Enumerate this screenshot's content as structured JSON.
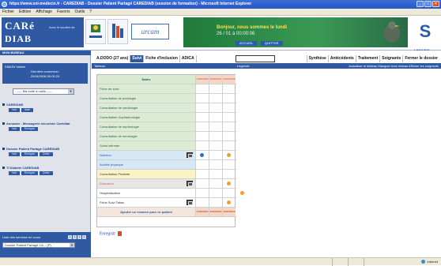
{
  "window": {
    "title": "https://www.sni-medecin.fr - CAREDIAB - Dossier Patient Partagé CAREDIAB (session de formation) - Microsoft Internet Explorer"
  },
  "menu": [
    "Fichier",
    "Edition",
    "Affichage",
    "Favoris",
    "Outils",
    "?"
  ],
  "header": {
    "logo_line1": "CARé",
    "logo_line2": "DIAB",
    "tagline": "Avec le soutien de",
    "urcam": "urcam",
    "date": "Bonjour, nous sommes le lundi",
    "time": "26 / 01 à 00:00:06",
    "btn_accueil": "ACCUEIL",
    "btn_quitter": "QUITTER",
    "right_logo": "S",
    "right_logo_sub": "LIMOUSIN"
  },
  "sidebar": {
    "header": "MON BUREAU",
    "user_line1": "SIMON Valérie",
    "user_line2": "Dernière connexion:",
    "user_line3": "20/04/2006 00:00:24",
    "select": "----- Ma boite à outils -----",
    "blocks": [
      {
        "title": "CAREDIAB",
        "buttons": [
          "Voir",
          "Aide"
        ]
      },
      {
        "title": "Annuaire - Messagerie sécurisée Carédiab",
        "buttons": [
          "Voir",
          "Envoyer"
        ]
      },
      {
        "title": "Dossier Patient Partagé CAREDIAB",
        "buttons": [
          "Voir",
          "Envoyer",
          "Créer"
        ]
      },
      {
        "title": "TI Diabète CAREDIAB",
        "buttons": [
          "Voir",
          "Envoyer",
          "Créer"
        ]
      }
    ],
    "footer_title": "Liste des services en cours",
    "footer_select": "Dossier Patient Partagé CA... (P)",
    "nav": [
      "1",
      "2",
      "3",
      "4"
    ]
  },
  "main": {
    "patient_tabs": [
      {
        "label": "A.DODO (27 ans)",
        "active": false
      },
      {
        "label": "Suivi",
        "active": true
      },
      {
        "label": "Fiche d'inclusion",
        "active": false
      },
      {
        "label": "ADICA",
        "active": false
      }
    ],
    "right_tabs": [
      "Synthèse",
      "Antécédents",
      "Traitement",
      "Soignants",
      "Fermer le dossier"
    ],
    "band_left": "Tableau",
    "band_mid": "Légende",
    "band_right": "Actualiser le tableau  Masquer hors réseau  Afficher les soignants",
    "grid_header_label": "Dates",
    "grid_header_cols": [
      "12/05/2005",
      "20/05/2005",
      "26/05/2005"
    ],
    "rows": [
      {
        "label": "Fiche de suivi",
        "style": "green"
      },
      {
        "label": "Consultation de podologie",
        "style": "green"
      },
      {
        "label": "Consultation de cardiologie",
        "style": "green"
      },
      {
        "label": "Consultation d'ophtalmologie",
        "style": "green"
      },
      {
        "label": "Consultation de néphrologie",
        "style": "green"
      },
      {
        "label": "Consultation de neurologie",
        "style": "green"
      },
      {
        "label": "Soins infirmier",
        "style": "green"
      },
      {
        "label": "Nutrition",
        "style": "lightblue",
        "icon": true,
        "dots": [
          {
            "col": 0,
            "color": "blue"
          },
          {
            "col": 2,
            "color": "orange"
          }
        ]
      },
      {
        "label": "Activité physique",
        "style": "lightblue"
      },
      {
        "label": "Consultation Pédiatre",
        "style": "yellow"
      },
      {
        "label": "Education",
        "style": "pinklabel",
        "icon": true,
        "dots": [
          {
            "col": 2,
            "color": "orange"
          }
        ]
      },
      {
        "label": "Hospitalisation",
        "style": "white",
        "dots": [
          {
            "col": 3,
            "color": "orange"
          }
        ]
      },
      {
        "label": "Fiche Suivi Tabac",
        "style": "white",
        "icon": true,
        "dots": [
          {
            "col": 2,
            "color": "orange"
          }
        ]
      }
    ],
    "footer_label": "Ajouter un examen pour ce patient",
    "footer_cols": [
      "12/05/2005",
      "20/05/2005",
      "26/05/2005"
    ],
    "enregistrer": "Enregistr"
  },
  "statusbar": {
    "right": "Internet"
  }
}
